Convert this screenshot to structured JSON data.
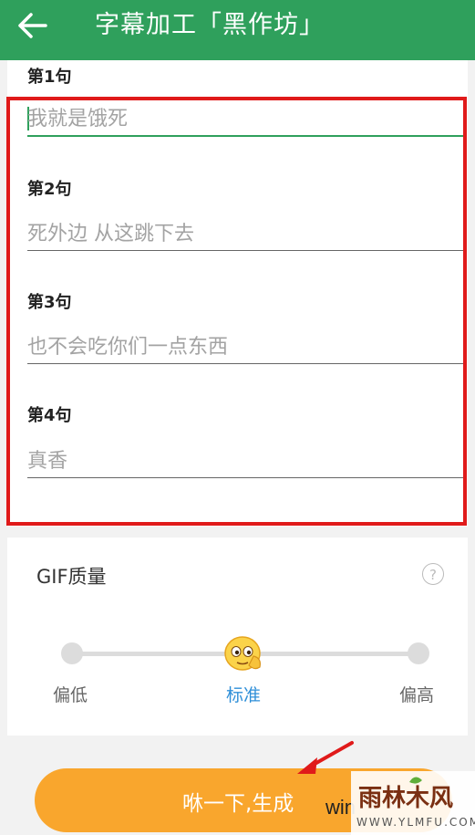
{
  "app_bar": {
    "title": "字幕加工「黑作坊」"
  },
  "sentences": [
    {
      "label": "第1句",
      "text": "我就是饿死"
    },
    {
      "label": "第2句",
      "text": "死外边 从这跳下去"
    },
    {
      "label": "第3句",
      "text": "也不会吃你们一点东西"
    },
    {
      "label": "第4句",
      "text": "真香"
    }
  ],
  "gif_quality": {
    "title": "GIF质量",
    "help": "?",
    "levels": [
      "偏低",
      "标准",
      "偏高"
    ],
    "selected": "标准"
  },
  "generate_button": {
    "label": "咻一下,生成"
  },
  "watermark": {
    "text": "雨林木风",
    "url": "WWW.YLMFU.COM",
    "partial": "win"
  },
  "colors": {
    "app_bar": "#2fa05c",
    "button": "#f9a62d",
    "annotation": "#e01a1a",
    "selected_level": "#2f8fd8"
  },
  "icons": {
    "back": "arrow-left-icon",
    "help": "question-circle-icon",
    "slider_thumb": "face-emoji-icon"
  }
}
